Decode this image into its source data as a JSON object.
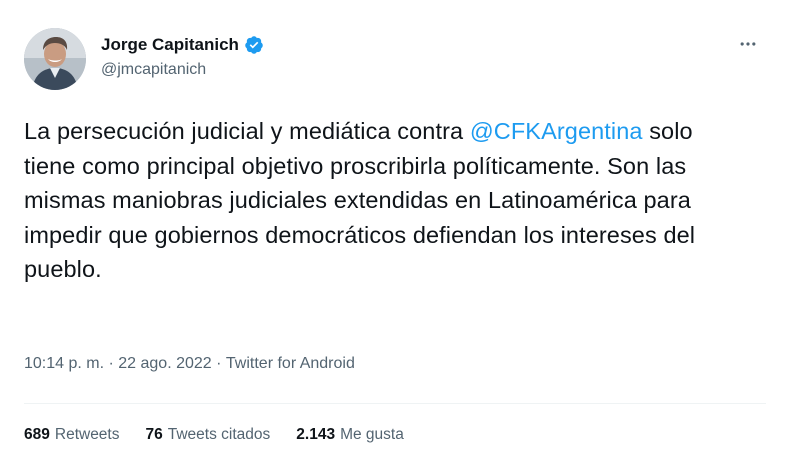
{
  "author": {
    "display_name": "Jorge Capitanich",
    "handle": "@jmcapitanich",
    "verified": true,
    "verified_color": "#1d9bf0"
  },
  "tweet": {
    "text_before": "La persecución judicial y mediática contra ",
    "mention": "@CFKArgentina",
    "text_after": " solo tiene como principal objetivo proscribirla políticamente. Son las mismas maniobras judiciales extendidas en Latinoamérica para impedir que gobiernos democráticos defiendan los intereses del pueblo.",
    "mention_color": "#1d9bf0"
  },
  "meta": {
    "time": "10:14 p. m.",
    "separator": " · ",
    "date": "22 ago. 2022",
    "source": "Twitter for Android"
  },
  "stats": {
    "retweets_count": "689",
    "retweets_label": "Retweets",
    "quotes_count": "76",
    "quotes_label": "Tweets citados",
    "likes_count": "2.143",
    "likes_label": "Me gusta"
  },
  "icons": {
    "more": "more-horizontal-icon",
    "verified": "verified-badge-icon"
  }
}
